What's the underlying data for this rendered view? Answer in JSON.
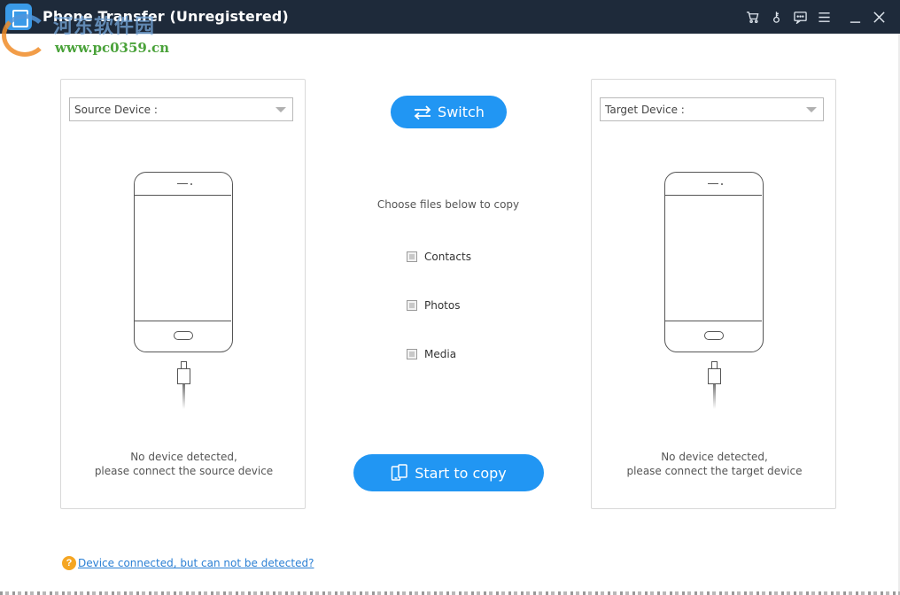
{
  "window": {
    "title": "Phone Transfer (Unregistered)",
    "watermark_text": "河东软件园",
    "watermark_url": "www.pc0359.cn",
    "toolbar_icons": [
      "cart-icon",
      "key-icon",
      "feedback-icon",
      "menu-icon",
      "minimize-icon",
      "close-icon"
    ]
  },
  "source": {
    "select_label": "Source Device :",
    "message_line1": "No device detected,",
    "message_line2": "please connect the source device"
  },
  "target": {
    "select_label": "Target Device :",
    "message_line1": "No device detected,",
    "message_line2": "please connect the target device"
  },
  "center": {
    "switch_label": "Switch",
    "choose_label": "Choose files below to copy",
    "options": [
      {
        "label": "Contacts",
        "checked": false
      },
      {
        "label": "Photos",
        "checked": false
      },
      {
        "label": "Media",
        "checked": false
      }
    ],
    "copy_label": "Start to copy"
  },
  "footer": {
    "help_icon": "?",
    "help_link": "Device connected, but can not be detected?"
  },
  "colors": {
    "titlebar": "#1e2a3a",
    "accent": "#2196f3",
    "link": "#2a7fd4",
    "help_icon": "#f5a623"
  }
}
